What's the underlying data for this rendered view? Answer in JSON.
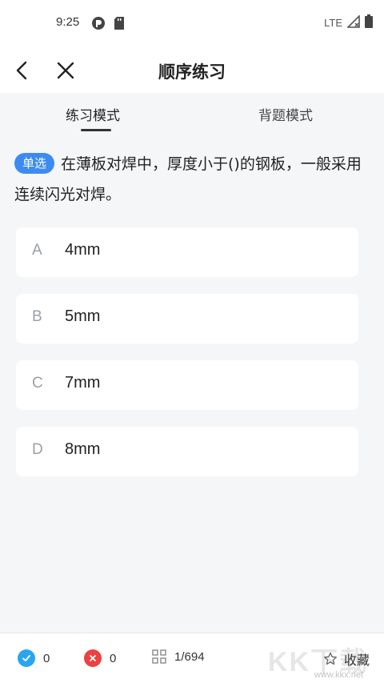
{
  "status_bar": {
    "time": "9:25",
    "network": "LTE"
  },
  "app_bar": {
    "title": "顺序练习"
  },
  "tabs": [
    {
      "label": "练习模式",
      "active": true
    },
    {
      "label": "背题模式",
      "active": false
    }
  ],
  "question": {
    "type_badge": "单选",
    "text": "在薄板对焊中，厚度小于()的钢板，一般采用连续闪光对焊。"
  },
  "options": [
    {
      "letter": "A",
      "text": "4mm"
    },
    {
      "letter": "B",
      "text": "5mm"
    },
    {
      "letter": "C",
      "text": "7mm"
    },
    {
      "letter": "D",
      "text": "8mm"
    }
  ],
  "bottom_bar": {
    "correct_count": "0",
    "wrong_count": "0",
    "progress": "1/694",
    "collect_label": "收藏"
  },
  "watermark": {
    "text": "KK下载",
    "url": "www.kkx.net"
  },
  "colors": {
    "accent": "#3d8bf2",
    "correct": "#2aa5f0",
    "wrong": "#ee4040"
  }
}
